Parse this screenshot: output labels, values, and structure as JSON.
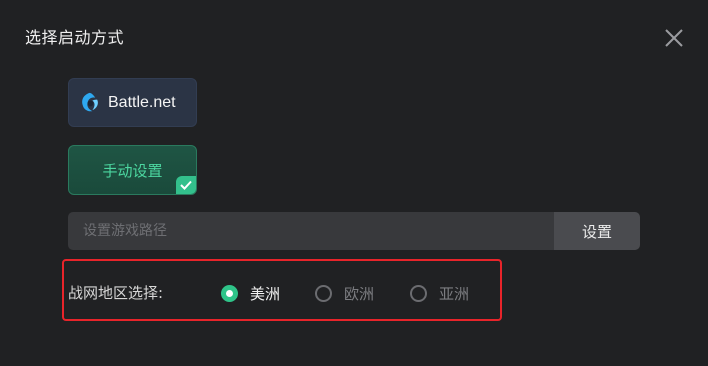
{
  "dialog": {
    "title": "选择启动方式"
  },
  "launch_options": {
    "battlenet_label": "Battle.net",
    "manual_label": "手动设置",
    "selected": "手动设置"
  },
  "path": {
    "placeholder": "设置游戏路径",
    "value": "",
    "button_label": "设置"
  },
  "region": {
    "label": "战网地区选择:",
    "options": [
      {
        "label": "美洲",
        "checked": true
      },
      {
        "label": "欧洲",
        "checked": false
      },
      {
        "label": "亚洲",
        "checked": false
      }
    ],
    "highlight_color": "#e8242a"
  },
  "colors": {
    "accent": "#2fc489",
    "background": "#202123"
  }
}
